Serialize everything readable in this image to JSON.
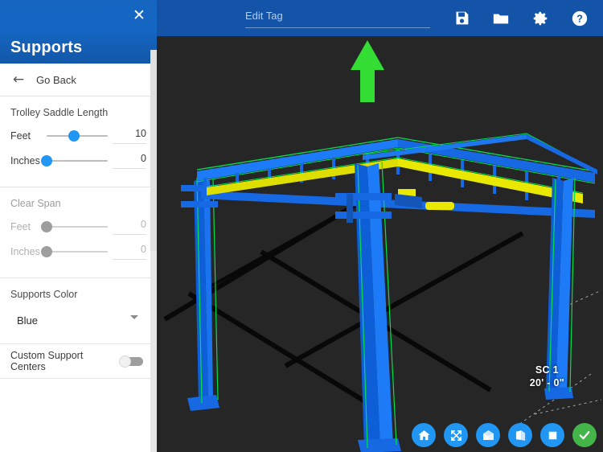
{
  "panel": {
    "title": "Supports",
    "close_icon": "close-icon",
    "go_back_label": "Go Back",
    "back_icon": "arrow-left-icon",
    "sections": [
      {
        "id": "trolley-saddle-length",
        "title": "Trolley Saddle Length",
        "disabled": false,
        "rows": [
          {
            "unit": "Feet",
            "value": "10",
            "percent": 45
          },
          {
            "unit": "Inches",
            "value": "0",
            "percent": 0
          }
        ]
      },
      {
        "id": "clear-span",
        "title": "Clear Span",
        "disabled": true,
        "rows": [
          {
            "unit": "Feet",
            "value": "0",
            "percent": 0
          },
          {
            "unit": "Inches",
            "value": "0",
            "percent": 0
          }
        ]
      }
    ],
    "supports_color": {
      "label": "Supports Color",
      "value": "Blue",
      "caret_icon": "chevron-down-icon"
    },
    "custom_support_centers": {
      "label": "Custom Support Centers",
      "state": "off"
    }
  },
  "topbar": {
    "tag_value": "",
    "tag_placeholder": "Edit Tag",
    "icons": [
      {
        "name": "save-icon",
        "glyph": "save"
      },
      {
        "name": "folder-icon",
        "glyph": "folder"
      },
      {
        "name": "settings-icon",
        "glyph": "gear"
      },
      {
        "name": "help-icon",
        "glyph": "question"
      }
    ]
  },
  "viewport": {
    "dimension_label_line1": "SC 1",
    "dimension_label_line2": "20' - 0\"",
    "background_color": "#262626",
    "model_colors": {
      "beam": "#1668e3",
      "edge_highlight": "#00e050",
      "rail": "#e8e800",
      "gizmo_arrow": "#33dd33"
    }
  },
  "bottom_toolbar": {
    "buttons": [
      {
        "name": "home-view-button",
        "glyph": "home"
      },
      {
        "name": "fit-to-screen-button",
        "glyph": "expand"
      },
      {
        "name": "view-3d-button",
        "glyph": "cube"
      },
      {
        "name": "view-angled-button",
        "glyph": "fold"
      },
      {
        "name": "view-flat-button",
        "glyph": "square"
      },
      {
        "name": "confirm-button",
        "glyph": "check"
      }
    ]
  },
  "colors": {
    "header_blue": "#1565c0",
    "topbar_blue": "#1454a8",
    "accent_blue": "#2196f3",
    "confirm_green": "#43b549"
  }
}
